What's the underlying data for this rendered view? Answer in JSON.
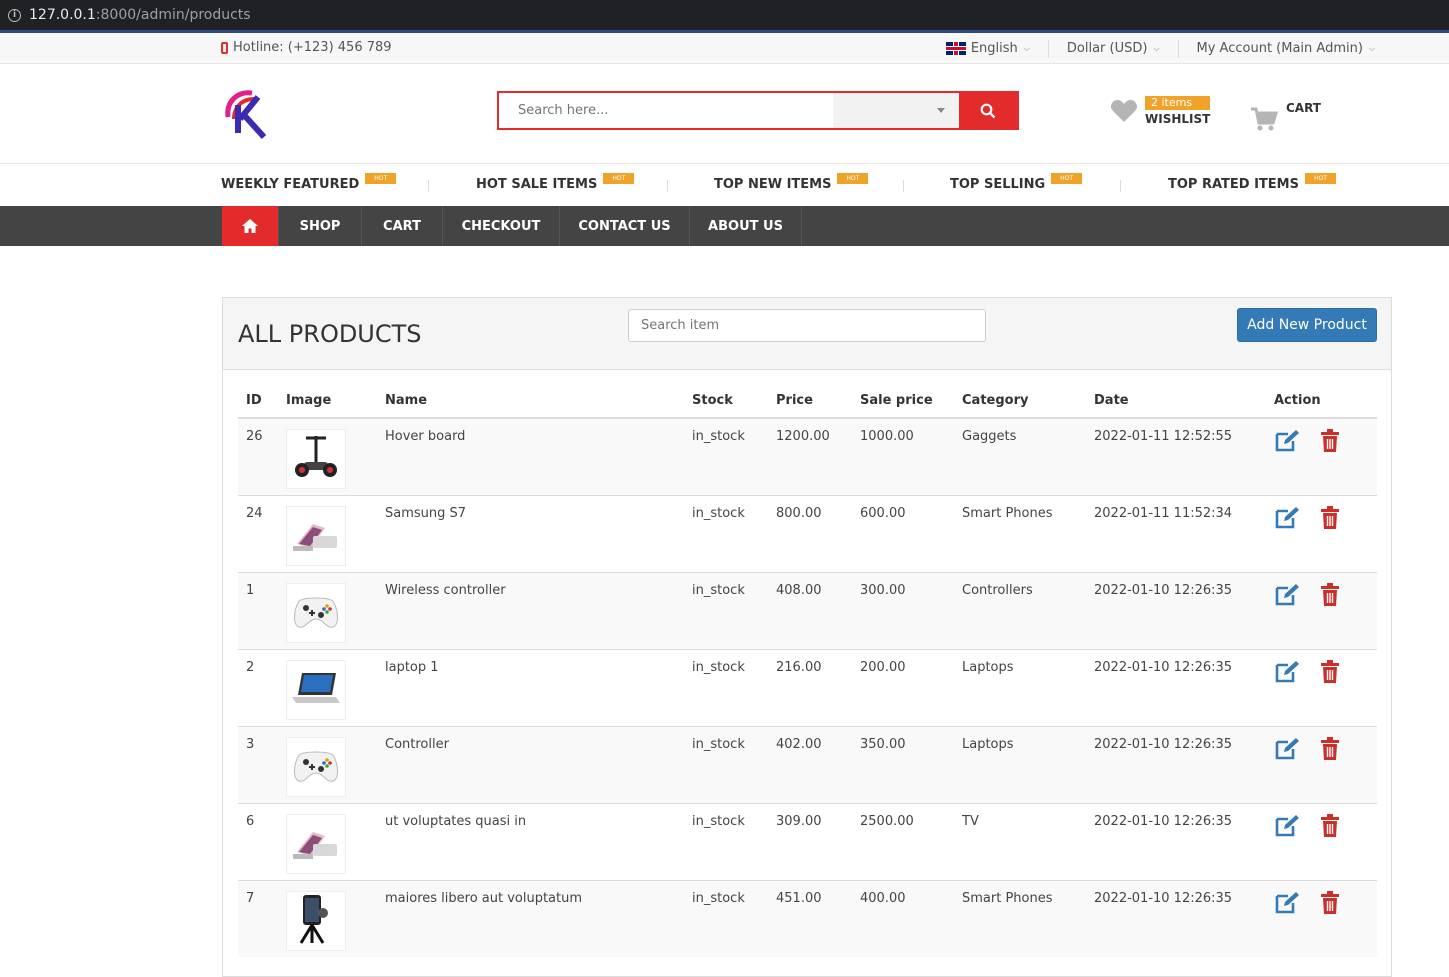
{
  "browser": {
    "host": "127.0.0.1",
    "path": ":8000/admin/products"
  },
  "topbar": {
    "hotline": "Hotline: (+123) 456 789",
    "language": "English",
    "currency": "Dollar (USD)",
    "account": "My Account (Main Admin)"
  },
  "header": {
    "search_placeholder": "Search here...",
    "wishlist_badge": "2 items",
    "wishlist_label": "WISHLIST",
    "cart_label": "CART"
  },
  "hot_links": {
    "tag": "HOT",
    "items": [
      "WEEKLY FEATURED",
      "HOT SALE ITEMS",
      "TOP NEW ITEMS",
      "TOP SELLING",
      "TOP RATED ITEMS"
    ]
  },
  "nav": {
    "items": [
      "SHOP",
      "CART",
      "CHECKOUT",
      "CONTACT US",
      "ABOUT US"
    ]
  },
  "panel": {
    "title": "ALL PRODUCTS",
    "search_placeholder": "Search item",
    "add_button": "Add New Product"
  },
  "table": {
    "headers": [
      "ID",
      "Image",
      "Name",
      "Stock",
      "Price",
      "Sale price",
      "Category",
      "Date",
      "Action"
    ],
    "rows": [
      {
        "id": "26",
        "image": "hoverboard",
        "name": "Hover board",
        "stock": "in_stock",
        "price": "1200.00",
        "sale": "1000.00",
        "category": "Gaggets",
        "date": "2022-01-11 12:52:55"
      },
      {
        "id": "24",
        "image": "phone",
        "name": "Samsung S7",
        "stock": "in_stock",
        "price": "800.00",
        "sale": "600.00",
        "category": "Smart Phones",
        "date": "2022-01-11 11:52:34"
      },
      {
        "id": "1",
        "image": "controller",
        "name": "Wireless controller",
        "stock": "in_stock",
        "price": "408.00",
        "sale": "300.00",
        "category": "Controllers",
        "date": "2022-01-10 12:26:35"
      },
      {
        "id": "2",
        "image": "laptop",
        "name": "laptop 1",
        "stock": "in_stock",
        "price": "216.00",
        "sale": "200.00",
        "category": "Laptops",
        "date": "2022-01-10 12:26:35"
      },
      {
        "id": "3",
        "image": "controller",
        "name": "Controller",
        "stock": "in_stock",
        "price": "402.00",
        "sale": "350.00",
        "category": "Laptops",
        "date": "2022-01-10 12:26:35"
      },
      {
        "id": "6",
        "image": "phone",
        "name": "ut voluptates quasi in",
        "stock": "in_stock",
        "price": "309.00",
        "sale": "2500.00",
        "category": "TV",
        "date": "2022-01-10 12:26:35"
      },
      {
        "id": "7",
        "image": "tripod-phone",
        "name": "maiores libero aut voluptatum",
        "stock": "in_stock",
        "price": "451.00",
        "sale": "400.00",
        "category": "Smart Phones",
        "date": "2022-01-10 12:26:35"
      }
    ]
  },
  "colors": {
    "accent": "#e32b2b",
    "hot": "#f0a329",
    "nav_bg": "#444444",
    "primary": "#337ab7",
    "edit": "#337ab7",
    "delete": "#c9302c"
  }
}
